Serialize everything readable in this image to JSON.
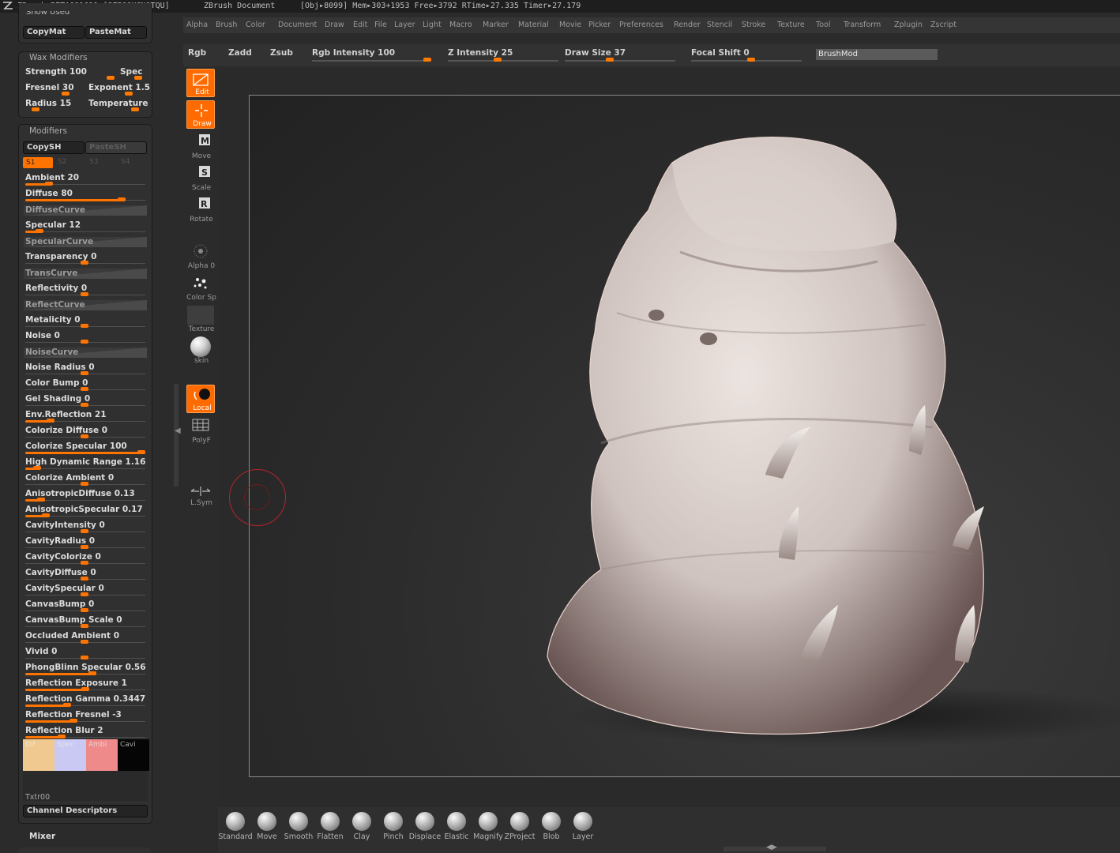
{
  "titlebar": {
    "app": "ZBrush BETA091611 [SFPOOKGNOTQU]",
    "document": "ZBrush Document",
    "stats": "[Obj▸8099] Mem▸303+1953 Free▸3792 RTime▸27.335 Timer▸27.179"
  },
  "menus": [
    "Alpha",
    "Brush",
    "Color",
    "Document",
    "Draw",
    "Edit",
    "File",
    "Layer",
    "Light",
    "Macro",
    "Marker",
    "Material",
    "Movie",
    "Picker",
    "Preferences",
    "Render",
    "Stencil",
    "Stroke",
    "Texture",
    "Tool",
    "Transform",
    "Zplugin",
    "Zscript"
  ],
  "topbar": {
    "rgb": "Rgb",
    "zadd": "Zadd",
    "zsub": "Zsub",
    "rgb_intensity": "Rgb Intensity 100",
    "z_intensity": "Z Intensity 25",
    "draw_size": "Draw Size 37",
    "focal_shift": "Focal Shift 0",
    "brushmod": "BrushMod"
  },
  "topbar_levels": {
    "rgb_intensity": 1.0,
    "z_intensity": 0.25,
    "draw_size": 0.37,
    "focal_shift": 0.5
  },
  "left_panel": {
    "top_partial": "Show Used",
    "copymat": "CopyMat",
    "pastemat": "PasteMat",
    "wax": {
      "title": "Wax Modifiers",
      "strength": "Strength 100",
      "spec": "Spec",
      "fresnel": "Fresnel 30",
      "exponent": "Exponent 1.5",
      "radius": "Radius 15",
      "temperature": "Temperature"
    },
    "modifiers": {
      "title": "Modifiers",
      "copysh": "CopySH",
      "pastesh": "PasteSH",
      "shaders": [
        "S1",
        "S2",
        "S3",
        "S4"
      ],
      "rows": [
        {
          "label": "Ambient 20",
          "level": 0.2
        },
        {
          "label": "Diffuse 80",
          "level": 0.8
        },
        {
          "label": "DiffuseCurve",
          "curve": true
        },
        {
          "label": "Specular 12",
          "level": 0.12
        },
        {
          "label": "SpecularCurve",
          "curve": true
        },
        {
          "label": "Transparency 0",
          "level": 0
        },
        {
          "label": "TransCurve",
          "curve": true
        },
        {
          "label": "Reflectivity 0",
          "level": 0
        },
        {
          "label": "ReflectCurve",
          "curve": true
        },
        {
          "label": "Metalicity 0",
          "level": 0
        },
        {
          "label": "Noise 0",
          "level": 0
        },
        {
          "label": "NoiseCurve",
          "curve": true
        },
        {
          "label": "Noise Radius 0",
          "level": 0
        },
        {
          "label": "Color Bump 0",
          "level": 0
        },
        {
          "label": "Gel Shading 0",
          "level": 0
        },
        {
          "label": "Env.Reflection 21",
          "level": 0.21
        },
        {
          "label": "Colorize Diffuse 0",
          "level": 0
        },
        {
          "label": "Colorize Specular 100",
          "level": 1.0
        },
        {
          "label": "High Dynamic Range 1.16",
          "level": 0.1
        },
        {
          "label": "Colorize Ambient 0",
          "level": 0
        },
        {
          "label": "AnisotropicDiffuse 0.13",
          "level": 0.13
        },
        {
          "label": "AnisotropicSpecular 0.17",
          "level": 0.17
        },
        {
          "label": "CavityIntensity 0",
          "level": 0
        },
        {
          "label": "CavityRadius 0",
          "level": 0
        },
        {
          "label": "CavityColorize 0",
          "level": 0
        },
        {
          "label": "CavityDiffuse 0",
          "level": 0
        },
        {
          "label": "CavitySpecular 0",
          "level": 0
        },
        {
          "label": "CanvasBump 0",
          "level": 0
        },
        {
          "label": "CanvasBump Scale 0",
          "level": 0
        },
        {
          "label": "Occluded Ambient 0",
          "level": 0
        },
        {
          "label": "Vivid 0",
          "level": 0
        },
        {
          "label": "PhongBlinn Specular 0.56",
          "level": 0.56
        },
        {
          "label": "Reflection Exposure 1",
          "level": 0.5
        },
        {
          "label": "Reflection Gamma 0.3447",
          "level": 0.35
        },
        {
          "label": "Reflection Fresnel -3",
          "level": 0.4
        },
        {
          "label": "Reflection Blur 2",
          "level": 0.3
        }
      ],
      "swatches": [
        {
          "label": "Dif",
          "color": "#efc98f"
        },
        {
          "label": "Spec",
          "color": "#c9c9f4"
        },
        {
          "label": "Ambi",
          "color": "#ee8a8a"
        },
        {
          "label": "Cavi",
          "color": "#050505"
        }
      ],
      "txtr": "Txtr00",
      "channel_descriptors": "Channel Descriptors"
    },
    "mixer": "Mixer"
  },
  "left_toolbar": [
    {
      "label": "Edit",
      "active": true
    },
    {
      "label": "Draw",
      "active": true
    },
    {
      "label": "Move",
      "key": "M"
    },
    {
      "label": "Scale",
      "key": "S"
    },
    {
      "label": "Rotate",
      "key": "R"
    },
    {
      "label": "Alpha 0"
    },
    {
      "label": "Color Sp"
    },
    {
      "label": "Texture"
    },
    {
      "label": "skin"
    },
    {
      "label": "Local",
      "active": true
    },
    {
      "label": "PolyF"
    },
    {
      "label": "L.Sym"
    }
  ],
  "shelf": [
    "Standard",
    "Move",
    "Smooth",
    "Flatten",
    "Clay",
    "Pinch",
    "Displace",
    "Elastic",
    "Magnify",
    "ZProject",
    "Blob",
    "Layer"
  ],
  "colors": {
    "accent": "#ff7400",
    "panel": "#303030",
    "canvas": "#2c2c2c",
    "model": "#d9cdc8",
    "cursor": "#b3262a"
  }
}
